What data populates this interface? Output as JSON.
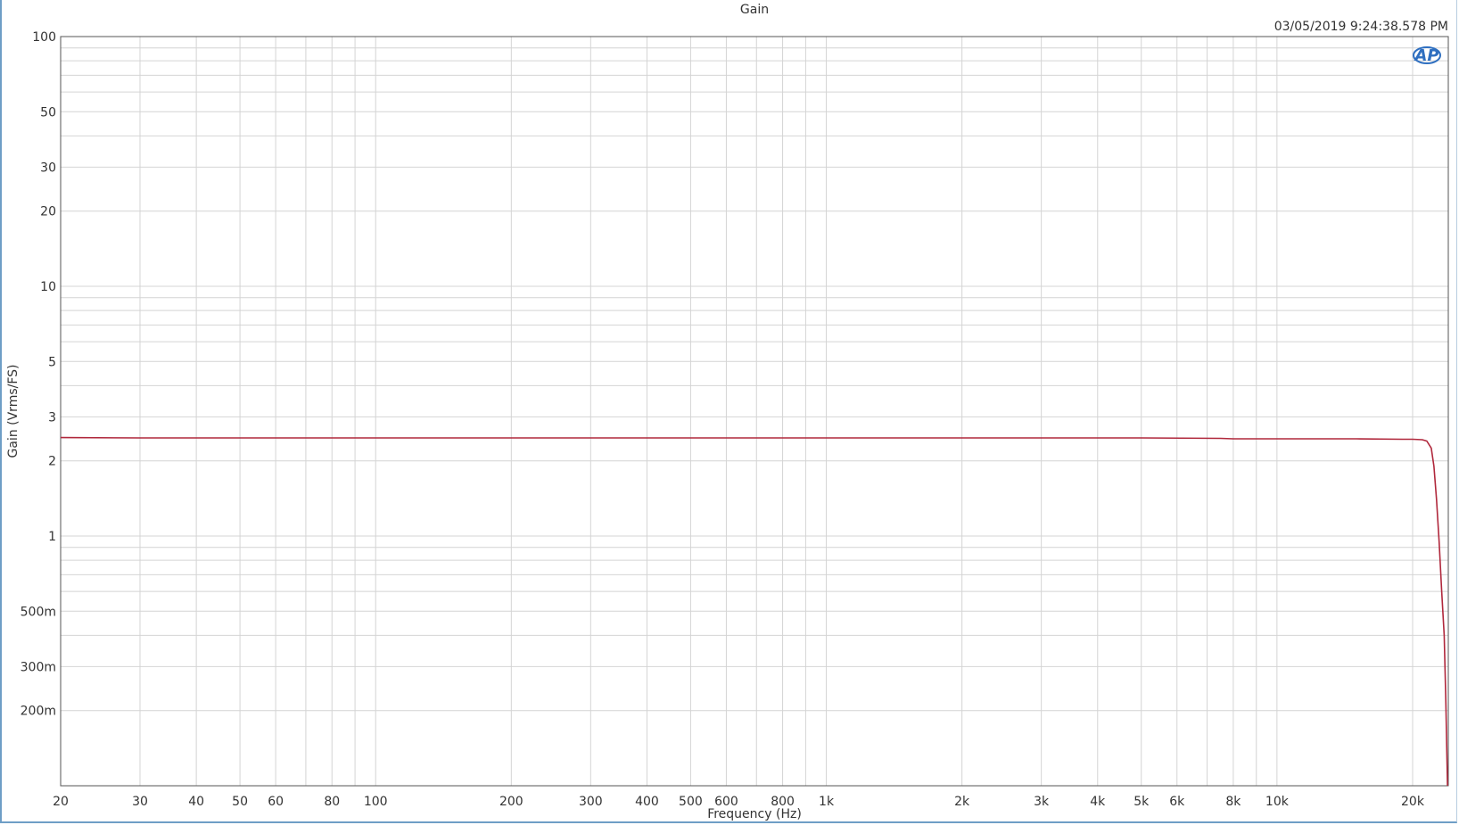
{
  "chart_data": {
    "type": "line",
    "title": "Gain",
    "timestamp": "03/05/2019 9:24:38.578 PM",
    "xlabel": "Frequency (Hz)",
    "ylabel": "Gain (Vrms/FS)",
    "xscale": "log",
    "yscale": "log",
    "xlim": [
      20,
      24000
    ],
    "ylim": [
      0.1,
      100
    ],
    "grid": true,
    "legend": "none",
    "x_ticks": [
      {
        "value": 20,
        "label": "20"
      },
      {
        "value": 30,
        "label": "30"
      },
      {
        "value": 40,
        "label": "40"
      },
      {
        "value": 50,
        "label": "50"
      },
      {
        "value": 60,
        "label": "60"
      },
      {
        "value": 80,
        "label": "80"
      },
      {
        "value": 100,
        "label": "100"
      },
      {
        "value": 200,
        "label": "200"
      },
      {
        "value": 300,
        "label": "300"
      },
      {
        "value": 400,
        "label": "400"
      },
      {
        "value": 500,
        "label": "500"
      },
      {
        "value": 600,
        "label": "600"
      },
      {
        "value": 800,
        "label": "800"
      },
      {
        "value": 1000,
        "label": "1k"
      },
      {
        "value": 2000,
        "label": "2k"
      },
      {
        "value": 3000,
        "label": "3k"
      },
      {
        "value": 4000,
        "label": "4k"
      },
      {
        "value": 5000,
        "label": "5k"
      },
      {
        "value": 6000,
        "label": "6k"
      },
      {
        "value": 8000,
        "label": "8k"
      },
      {
        "value": 10000,
        "label": "10k"
      },
      {
        "value": 20000,
        "label": "20k"
      }
    ],
    "y_ticks": [
      {
        "value": 100,
        "label": "100"
      },
      {
        "value": 50,
        "label": "50"
      },
      {
        "value": 30,
        "label": "30"
      },
      {
        "value": 20,
        "label": "20"
      },
      {
        "value": 10,
        "label": "10"
      },
      {
        "value": 5,
        "label": "5"
      },
      {
        "value": 3,
        "label": "3"
      },
      {
        "value": 2,
        "label": "2"
      },
      {
        "value": 1,
        "label": "1"
      },
      {
        "value": 0.5,
        "label": "500m"
      },
      {
        "value": 0.3,
        "label": "300m"
      },
      {
        "value": 0.2,
        "label": "200m"
      }
    ],
    "series": [
      {
        "color": "#b0283c",
        "x": [
          20,
          30,
          50,
          100,
          200,
          500,
          1000,
          2000,
          5000,
          7500,
          8000,
          10000,
          15000,
          19000,
          20000,
          21000,
          21500,
          22000,
          22300,
          22600,
          22900,
          23200,
          23500,
          23700,
          23900
        ],
        "y": [
          2.48,
          2.47,
          2.47,
          2.47,
          2.47,
          2.47,
          2.47,
          2.47,
          2.47,
          2.46,
          2.45,
          2.45,
          2.45,
          2.44,
          2.44,
          2.43,
          2.4,
          2.25,
          1.9,
          1.4,
          0.95,
          0.6,
          0.4,
          0.22,
          0.1
        ]
      }
    ]
  },
  "logo": {
    "text": "AP"
  },
  "colors": {
    "grid": "#d4d4d4",
    "axis": "#333333",
    "trace": "#b0283c",
    "frame": "#6e9ec6",
    "logo": "#2f6fc0"
  }
}
